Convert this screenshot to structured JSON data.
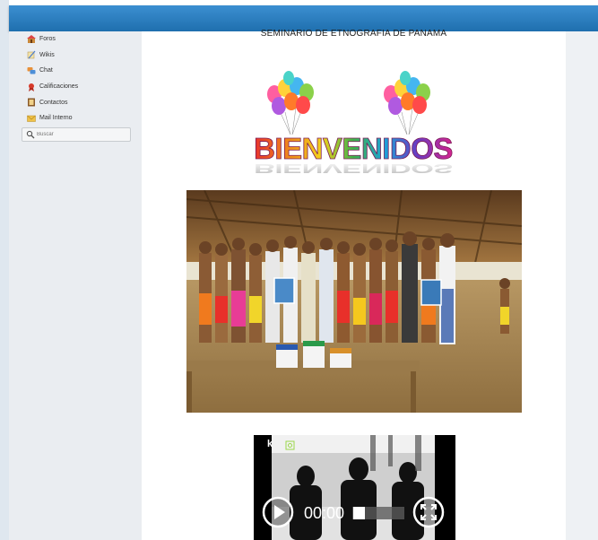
{
  "sidebar": {
    "items": [
      {
        "label": "Foros",
        "icon": "forum-icon"
      },
      {
        "label": "Wikis",
        "icon": "wiki-icon"
      },
      {
        "label": "Chat",
        "icon": "chat-icon"
      },
      {
        "label": "Calificaciones",
        "icon": "grades-icon"
      },
      {
        "label": "Contactos",
        "icon": "contacts-icon"
      },
      {
        "label": "Mail Interno",
        "icon": "mail-icon"
      }
    ],
    "search_placeholder": "Buscar"
  },
  "main": {
    "title": "SEMINARIO DE ETNOGRAFIA DE PANAMA",
    "welcome_text": "BIENVENIDOS",
    "video": {
      "time": "00:00",
      "logo": "k"
    }
  },
  "colors": {
    "topbar": "#2a7fc0",
    "sidebar": "#eaedf1"
  }
}
